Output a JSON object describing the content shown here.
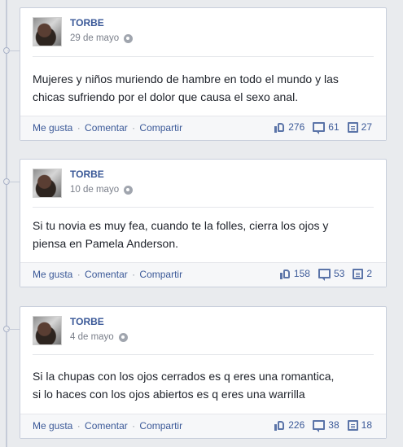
{
  "posts": [
    {
      "author": "TORBE",
      "date": "29 de mayo",
      "text_line1": "Mujeres y niños muriendo de hambre en todo el mundo y las",
      "text_line2": "chicas sufriendo por el dolor que causa el sexo anal.",
      "actions": {
        "like": "Me gusta",
        "comment": "Comentar",
        "share": "Compartir",
        "sep": "·"
      },
      "counts": {
        "likes": "276",
        "comments": "61",
        "shares": "27"
      }
    },
    {
      "author": "TORBE",
      "date": "10 de mayo",
      "text_line1": "Si tu novia es muy fea, cuando te la folles, cierra los ojos y",
      "text_line2": "piensa en Pamela Anderson.",
      "actions": {
        "like": "Me gusta",
        "comment": "Comentar",
        "share": "Compartir",
        "sep": "·"
      },
      "counts": {
        "likes": "158",
        "comments": "53",
        "shares": "2"
      }
    },
    {
      "author": "TORBE",
      "date": "4 de mayo",
      "text_line1": "Si la chupas con los ojos cerrados es q eres una romantica,",
      "text_line2": "si lo haces con los ojos abiertos es q eres una warrilla",
      "actions": {
        "like": "Me gusta",
        "comment": "Comentar",
        "share": "Compartir",
        "sep": "·"
      },
      "counts": {
        "likes": "226",
        "comments": "38",
        "shares": "18"
      }
    }
  ]
}
